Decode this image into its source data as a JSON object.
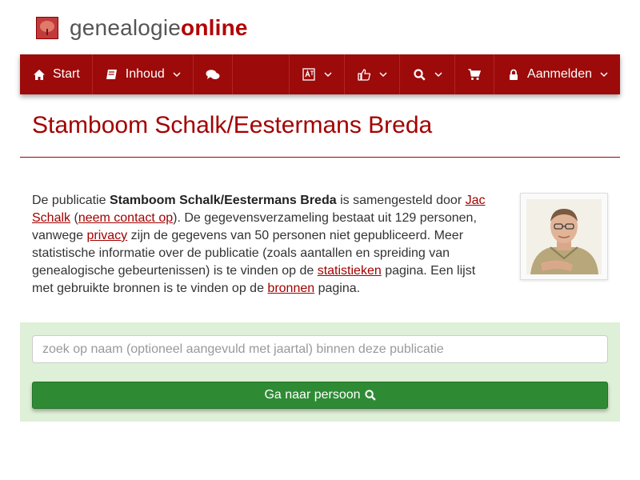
{
  "brand": {
    "part1": "genealogie",
    "part2": "online",
    "logo_icon": "tree-icon"
  },
  "nav": {
    "start": "Start",
    "inhoud": "Inhoud",
    "aanmelden": "Aanmelden"
  },
  "page": {
    "title": "Stamboom Schalk/Eestermans Breda"
  },
  "intro": {
    "t1": "De publicatie ",
    "pub_name": "Stamboom Schalk/Eestermans Breda",
    "t2": " is samengesteld door ",
    "author": "Jac Schalk",
    "t3": " (",
    "contact": "neem contact op",
    "t4": "). De gegevensverzameling bestaat uit 129 personen, vanwege ",
    "privacy": "privacy",
    "t5": " zijn de gegevens van 50 personen niet gepubliceerd. Meer statistische informatie over de publicatie (zoals aantallen en spreiding van genealogische gebeurtenissen) is te vinden op de ",
    "stats": "statistieken",
    "t6": " pagina. Een lijst met gebruikte bronnen is te vinden op de ",
    "sources": "bronnen",
    "t7": " pagina."
  },
  "search": {
    "placeholder": "zoek op naam (optioneel aangevuld met jaartal) binnen deze publicatie",
    "button_label": "Ga naar persoon"
  },
  "colors": {
    "brand": "#9c0a0a",
    "title": "#a30000",
    "panel": "#dff0d8",
    "button": "#2e8b34"
  }
}
